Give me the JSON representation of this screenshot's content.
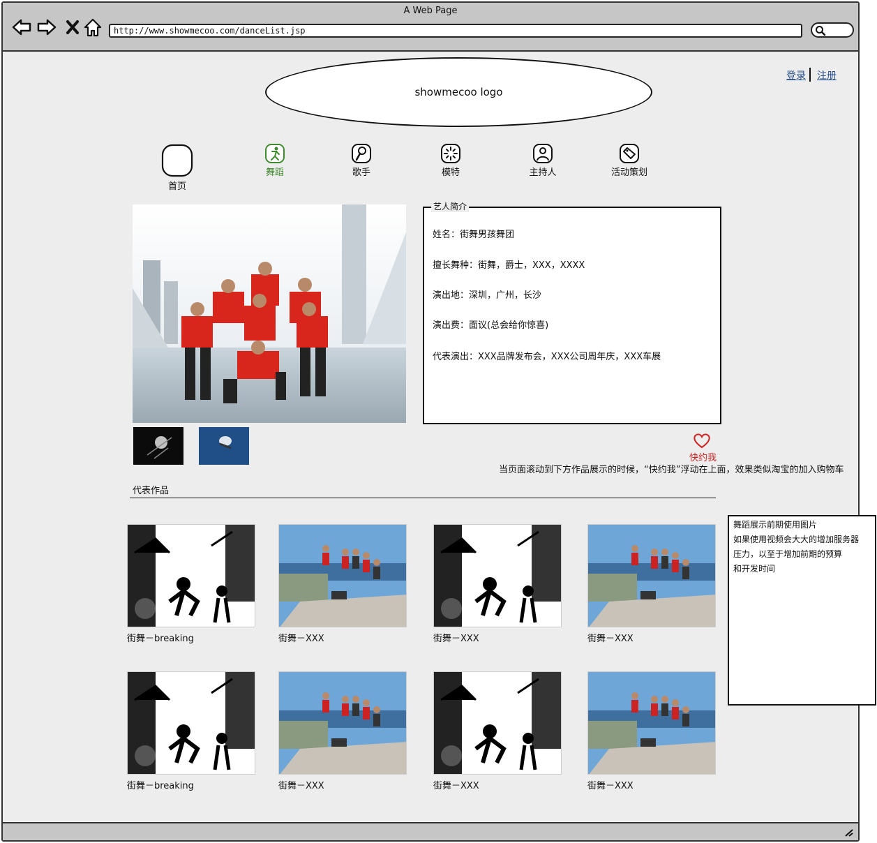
{
  "browser": {
    "window_title": "A Web Page",
    "url": "http://www.showmecoo.com/danceList.jsp"
  },
  "header": {
    "logo_text": "showmecoo logo",
    "login_label": "登录",
    "register_label": "注册"
  },
  "nav": {
    "items": [
      {
        "label": "首页",
        "icon": "home-icon"
      },
      {
        "label": "舞蹈",
        "icon": "dance-icon",
        "active": true
      },
      {
        "label": "歌手",
        "icon": "microphone-icon"
      },
      {
        "label": "模特",
        "icon": "model-icon"
      },
      {
        "label": "主持人",
        "icon": "host-icon"
      },
      {
        "label": "活动策划",
        "icon": "tag-icon"
      }
    ]
  },
  "profile": {
    "legend": "艺人简介",
    "lines": [
      "姓名：街舞男孩舞团",
      "擅长舞种：街舞，爵士，XXX，XXXX",
      "演出地：深圳，广州，长沙",
      "演出费：面议(总会给你惊喜)",
      "代表演出：XXX品牌发布会，XXX公司周年庆，XXX车展"
    ]
  },
  "booking": {
    "label": "快约我",
    "float_note": "当页面滚动到下方作品展示的时候，“快约我”浮动在上面，效果类似淘宝的加入购物车"
  },
  "works": {
    "title": "代表作品",
    "items": [
      {
        "caption": "街舞－breaking"
      },
      {
        "caption": "街舞－XXX"
      },
      {
        "caption": "街舞－XXX"
      },
      {
        "caption": "街舞－XXX"
      },
      {
        "caption": "街舞－breaking"
      },
      {
        "caption": "街舞－XXX"
      },
      {
        "caption": "街舞－XXX"
      },
      {
        "caption": "街舞－XXX"
      }
    ]
  },
  "note": {
    "lines": [
      "舞蹈展示前期使用图片",
      "如果使用视频会大大的增加服务器",
      "压力，以至于增加前期的预算",
      "和开发时间"
    ]
  }
}
